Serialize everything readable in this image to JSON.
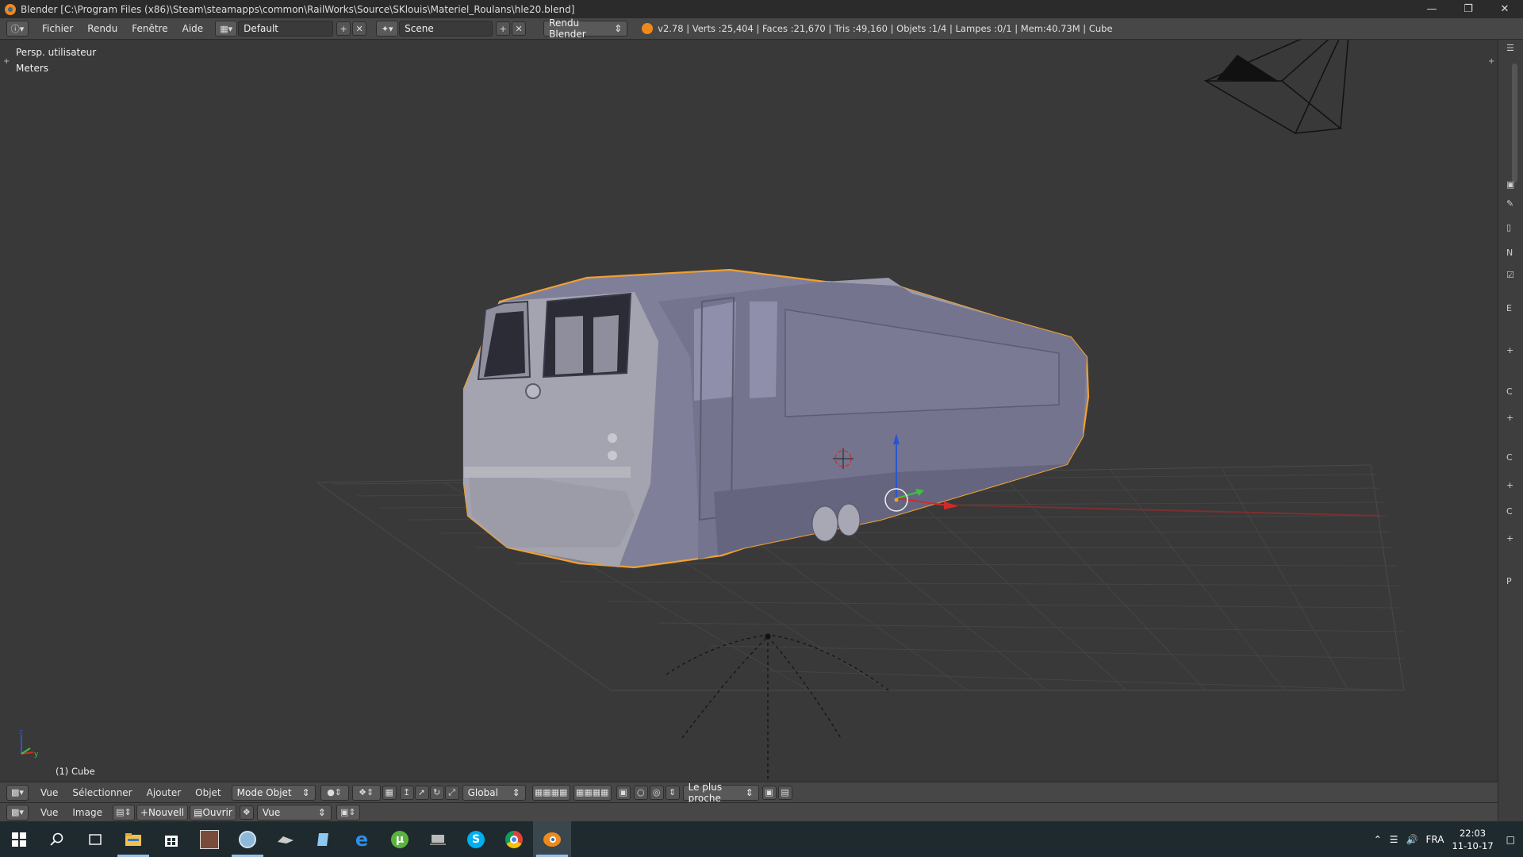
{
  "window": {
    "title": "Blender [C:\\Program Files (x86)\\Steam\\steamapps\\common\\RailWorks\\Source\\SKlouis\\Materiel_Roulans\\hle20.blend]",
    "controls": [
      "minimize-icon",
      "restore-icon",
      "close-icon"
    ]
  },
  "info_header": {
    "menus": [
      "Fichier",
      "Rendu",
      "Fenêtre",
      "Aide"
    ],
    "layout": "Default",
    "scene": "Scene",
    "render_engine": "Rendu Blender",
    "stats": "v2.78 | Verts :25,404 | Faces :21,670 | Tris :49,160 | Objets :1/4 | Lampes :0/1 | Mem:40.73M | Cube"
  },
  "viewport": {
    "view_name": "Persp. utilisateur",
    "units": "Meters",
    "active_object": "(1) Cube"
  },
  "view3d_header": {
    "menus": [
      "Vue",
      "Sélectionner",
      "Ajouter",
      "Objet"
    ],
    "mode": "Mode Objet",
    "orientation": "Global",
    "snap_target": "Le plus proche"
  },
  "image_editor_header": {
    "menus": [
      "Vue",
      "Image"
    ],
    "new_label": "Nouvell",
    "open_label": "Ouvrir",
    "view_select": "Vue"
  },
  "right_panel": {
    "labels": [
      "N",
      "E",
      "C",
      "C",
      "C",
      "P"
    ]
  },
  "taskbar": {
    "apps": [
      "windows-start-icon",
      "search-icon",
      "task-view-icon",
      "file-explorer-icon",
      "store-icon",
      "photo-app-icon",
      "paint-app-icon",
      "tool-icon",
      "notepad-icon",
      "edge-icon",
      "utorrent-icon",
      "railworks-icon",
      "skype-icon",
      "chrome-icon",
      "blender-icon"
    ],
    "language": "FRA",
    "time": "22:03",
    "date": "11-10-17"
  },
  "colors": {
    "selection_outline": "#f0a030",
    "mesh": "#7f7f99",
    "x_axis": "#d12a2a",
    "y_axis": "#3ec43e",
    "z_axis": "#2a55d1",
    "background": "#393939"
  }
}
